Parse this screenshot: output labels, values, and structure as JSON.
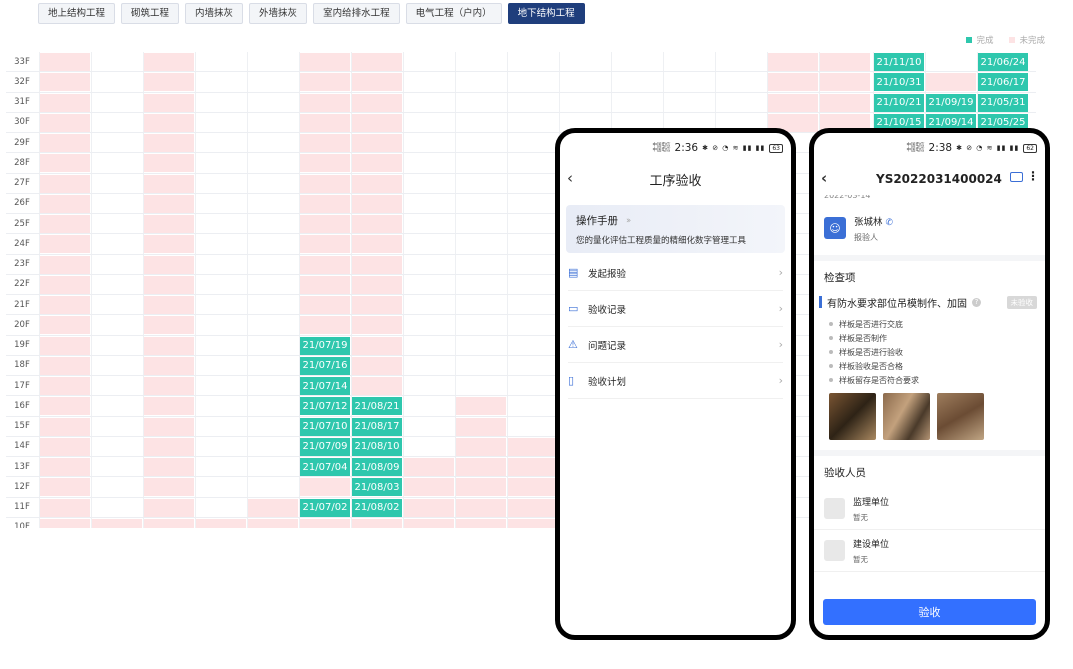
{
  "tabs": [
    {
      "label": "地上结构工程",
      "active": false
    },
    {
      "label": "砌筑工程",
      "active": false
    },
    {
      "label": "内墙抹灰",
      "active": false
    },
    {
      "label": "外墙抹灰",
      "active": false
    },
    {
      "label": "室内给排水工程",
      "active": false
    },
    {
      "label": "电气工程（户内）",
      "active": false
    },
    {
      "label": "地下结构工程",
      "active": true
    }
  ],
  "legend": [
    {
      "label": "完成",
      "color": "#2ec7ad"
    },
    {
      "label": "未完成",
      "color": "#fde3e4"
    }
  ],
  "floors": [
    "33F",
    "32F",
    "31F",
    "30F",
    "29F",
    "28F",
    "27F",
    "26F",
    "25F",
    "24F",
    "23F",
    "22F",
    "21F",
    "20F",
    "19F",
    "18F",
    "17F",
    "16F",
    "15F",
    "14F",
    "13F",
    "12F",
    "11F",
    "10F"
  ],
  "grid": {
    "33F": {
      "pink": [
        0,
        2,
        5,
        6,
        14,
        15,
        16
      ],
      "done": {
        "16": "21/11/10",
        "18": "21/06/24"
      }
    },
    "32F": {
      "pink": [
        0,
        2,
        5,
        6,
        14,
        15,
        17
      ],
      "done": {
        "16": "21/10/31",
        "18": "21/06/17"
      }
    },
    "31F": {
      "pink": [
        0,
        2,
        5,
        6,
        14,
        15
      ],
      "done": {
        "16": "21/10/21",
        "17": "21/09/19",
        "18": "21/05/31"
      }
    },
    "30F": {
      "pink": [
        0,
        2,
        5,
        6,
        14,
        15
      ],
      "done": {
        "16": "21/10/15",
        "17": "21/09/14",
        "18": "21/05/25"
      }
    },
    "29F": {
      "pink": [
        0,
        2,
        5,
        6
      ],
      "done": {}
    },
    "28F": {
      "pink": [
        0,
        2,
        5,
        6
      ],
      "done": {}
    },
    "27F": {
      "pink": [
        0,
        2,
        5,
        6
      ],
      "done": {}
    },
    "26F": {
      "pink": [
        0,
        2,
        5,
        6
      ],
      "done": {}
    },
    "25F": {
      "pink": [
        0,
        2,
        5,
        6
      ],
      "done": {}
    },
    "24F": {
      "pink": [
        0,
        2,
        5,
        6
      ],
      "done": {}
    },
    "23F": {
      "pink": [
        0,
        2,
        5,
        6
      ],
      "done": {}
    },
    "22F": {
      "pink": [
        0,
        2,
        5,
        6
      ],
      "done": {}
    },
    "21F": {
      "pink": [
        0,
        2,
        5,
        6
      ],
      "done": {}
    },
    "20F": {
      "pink": [
        0,
        2,
        5,
        6
      ],
      "done": {}
    },
    "19F": {
      "pink": [
        0,
        2,
        6
      ],
      "done": {
        "5": "21/07/19"
      }
    },
    "18F": {
      "pink": [
        0,
        2,
        6
      ],
      "done": {
        "5": "21/07/16"
      }
    },
    "17F": {
      "pink": [
        0,
        2,
        6
      ],
      "done": {
        "5": "21/07/14"
      }
    },
    "16F": {
      "pink": [
        0,
        2,
        8
      ],
      "done": {
        "5": "21/07/12",
        "6": "21/08/21"
      }
    },
    "15F": {
      "pink": [
        0,
        2,
        8
      ],
      "done": {
        "5": "21/07/10",
        "6": "21/08/17"
      }
    },
    "14F": {
      "pink": [
        0,
        2,
        8,
        9
      ],
      "done": {
        "5": "21/07/09",
        "6": "21/08/10"
      }
    },
    "13F": {
      "pink": [
        0,
        2,
        7,
        8,
        9
      ],
      "done": {
        "5": "21/07/04",
        "6": "21/08/09"
      }
    },
    "12F": {
      "pink": [
        0,
        2,
        5,
        7,
        8,
        9
      ],
      "done": {
        "6": "21/08/03"
      }
    },
    "11F": {
      "pink": [
        0,
        2,
        4,
        7,
        8,
        9
      ],
      "done": {
        "5": "21/07/02",
        "6": "21/08/02"
      }
    },
    "10F": {
      "pink": [
        0,
        1,
        2,
        3,
        4,
        5,
        6,
        7,
        8,
        9
      ],
      "done": {}
    }
  },
  "phone1": {
    "status": {
      "carrier1": "中国电信",
      "carrier2": "中国电信",
      "time": "2:36",
      "icons": "✱ ⊘ ◔ ≋ ▮▮ ▮▮",
      "battery": "63"
    },
    "title": "工序验收",
    "manual": {
      "title": "操作手册",
      "desc": "您的量化评估工程质量的精细化数字管理工具"
    },
    "menu": [
      {
        "label": "发起报验",
        "icon": "▤"
      },
      {
        "label": "验收记录",
        "icon": "▭"
      },
      {
        "label": "问题记录",
        "icon": "⚠"
      },
      {
        "label": "验收计划",
        "icon": "▯"
      }
    ]
  },
  "phone2": {
    "status": {
      "carrier1": "中国电信",
      "carrier2": "中国电信",
      "time": "2:38",
      "icons": "✱ ⊘ ◔ ≋ ▮▮ ▮▮",
      "battery": "62"
    },
    "title": "YS2022031400024",
    "date_cut": "2022-03-14",
    "reporter": {
      "name": "张城林",
      "role": "报验人"
    },
    "check_section": "检查项",
    "item": {
      "title": "有防水要求部位吊模制作、加固",
      "tag": "未验收",
      "checks": [
        "样板是否进行交底",
        "样板是否制作",
        "样板是否进行验收",
        "样板验收是否合格",
        "样板留存是否符合要求"
      ]
    },
    "people_section": "验收人员",
    "people": [
      {
        "role": "监理单位",
        "value": "暂无"
      },
      {
        "role": "建设单位",
        "value": "暂无"
      }
    ],
    "button": "验收"
  }
}
